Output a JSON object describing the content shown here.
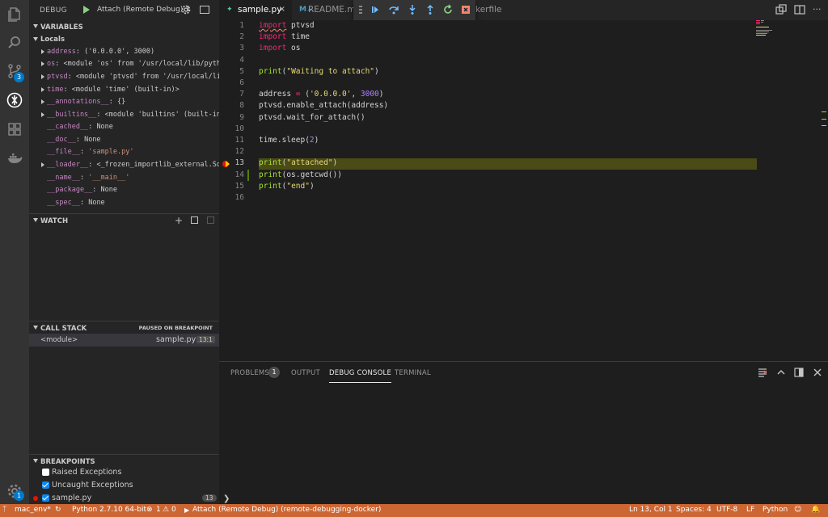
{
  "activity_bar": {
    "scm_badge": "3",
    "settings_badge": "1"
  },
  "debug": {
    "title": "DEBUG",
    "config": "Attach (Remote Debug) ↕"
  },
  "variables": {
    "header": "VARIABLES",
    "scope": "Locals",
    "items": [
      {
        "name": "address",
        "value": "('0.0.0.0', 3000)"
      },
      {
        "name": "os",
        "value": "<module 'os' from '/usr/local/lib/python…"
      },
      {
        "name": "ptvsd",
        "value": "<module 'ptvsd' from '/usr/local/lib/…"
      },
      {
        "name": "time",
        "value": "<module 'time' (built-in)>"
      },
      {
        "name": "__annotations__",
        "value": "{}"
      },
      {
        "name": "__builtins__",
        "value": "<module 'builtins' (built-in)>"
      },
      {
        "name": "__cached__",
        "value": "None"
      },
      {
        "name": "__doc__",
        "value": "None"
      },
      {
        "name": "__file__",
        "value": "'sample.py'"
      },
      {
        "name": "__loader__",
        "value": "<_frozen_importlib_external.Sour…"
      },
      {
        "name": "__name__",
        "value": "'__main__'"
      },
      {
        "name": "__package__",
        "value": "None"
      },
      {
        "name": "__spec__",
        "value": "None"
      }
    ]
  },
  "watch": {
    "header": "WATCH"
  },
  "call_stack": {
    "header": "CALL STACK",
    "status": "PAUSED ON BREAKPOINT",
    "frame": {
      "name": "<module>",
      "file": "sample.py",
      "pos": "13:1"
    }
  },
  "breakpoints": {
    "header": "BREAKPOINTS",
    "items": [
      {
        "label": "Raised Exceptions",
        "checked": false
      },
      {
        "label": "Uncaught Exceptions",
        "checked": true
      },
      {
        "label": "sample.py",
        "checked": true,
        "count": "13"
      }
    ]
  },
  "tabs": [
    {
      "label": "sample.py",
      "active": true
    },
    {
      "label": "README.md",
      "active": false
    },
    {
      "label": "kerfile",
      "active": false
    }
  ],
  "editor": {
    "lines": [
      "1",
      "2",
      "3",
      "4",
      "5",
      "6",
      "7",
      "8",
      "9",
      "10",
      "11",
      "12",
      "13",
      "14",
      "15",
      "16"
    ],
    "code": {
      "l1": {
        "kw": "import",
        "rest": " ptvsd"
      },
      "l2": {
        "kw": "import",
        "rest": " time"
      },
      "l3": {
        "kw": "import",
        "rest": " os"
      },
      "l5": {
        "fn": "print",
        "p1": "(",
        "st": "\"Waiting to attach\"",
        "p2": ")"
      },
      "l7": {
        "a": "address ",
        "eq": "=",
        "b": " (",
        "st": "'0.0.0.0'",
        "c": ", ",
        "nu": "3000",
        "d": ")"
      },
      "l8": {
        "a": "ptvsd.enable_attach(address)"
      },
      "l9": {
        "a": "ptvsd.wait_for_attach()"
      },
      "l11": {
        "a": "time.sleep(",
        "nu": "2",
        "b": ")"
      },
      "l13": {
        "fn": "print",
        "p1": "(",
        "st": "\"attached\"",
        "p2": ")"
      },
      "l14": {
        "fn": "print",
        "a": "(os.getcwd())"
      },
      "l15": {
        "fn": "print",
        "p1": "(",
        "st": "\"end\"",
        "p2": ")"
      }
    }
  },
  "panel": {
    "tabs": [
      "PROBLEMS",
      "OUTPUT",
      "DEBUG CONSOLE",
      "TERMINAL"
    ],
    "problems_count": "1",
    "prompt": "❯"
  },
  "status_bar": {
    "branch": "mac_env*",
    "python": "Python 2.7.10 64-bit",
    "errors": "1",
    "warnings": "0",
    "debug": "Attach (Remote Debug) (remote-debugging-docker)",
    "position": "Ln 13, Col 1",
    "spaces": "Spaces: 4",
    "encoding": "UTF-8",
    "eol": "LF",
    "language": "Python"
  },
  "colors": {
    "status_bar": "#cc6633",
    "accent": "#007acc",
    "breakpoint": "#e51400"
  }
}
